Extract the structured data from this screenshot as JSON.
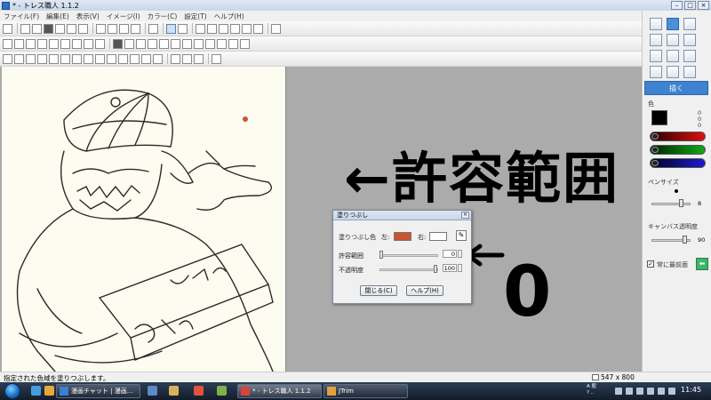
{
  "window": {
    "title": "* - トレス職人 1.1.2"
  },
  "menu": [
    "ファイル(F)",
    "編集(E)",
    "表示(V)",
    "イメージ(I)",
    "カラー(C)",
    "設定(T)",
    "ヘルプ(H)"
  ],
  "annotations": {
    "range_label": "←許容範囲",
    "zero_label": "0"
  },
  "fill_dialog": {
    "title": "塗りつぶし",
    "fill_color_label": "塗りつぶし色",
    "left_label": "左:",
    "right_label": "右:",
    "left_color": "#c8552e",
    "right_color": "#ffffff",
    "tolerance_label": "許容範囲",
    "tolerance_value": "0",
    "tolerance_level": 0,
    "opacity_label": "不透明度",
    "opacity_value": "100",
    "opacity_level": 100,
    "close_button": "閉じる(C)",
    "help_button": "ヘルプ(H)"
  },
  "right_panel": {
    "draw_button": "描く",
    "color_label": "色",
    "rgb": [
      "0",
      "0",
      "0"
    ],
    "pen_size_label": "ペンサイズ",
    "pen_size_value": "8",
    "pen_size_level": 8,
    "canvas_opacity_label": "キャンバス透明度",
    "canvas_opacity_value": "90",
    "canvas_opacity_level": 90,
    "always_front_label": "常に最前面",
    "always_front_checked": true
  },
  "status": {
    "message": "指定された色域を塗りつぶします。",
    "dimensions": "547 x 800"
  },
  "taskbar": {
    "buttons": [
      {
        "label": "漫画チャット | 漫画..."
      },
      {
        "label": "* - トレス職人 1.1.2"
      },
      {
        "label": "JTrim"
      }
    ],
    "clock": "11:45"
  },
  "colors": {
    "accent": "#3f82cf",
    "fill_swatch": "#c8552e"
  }
}
